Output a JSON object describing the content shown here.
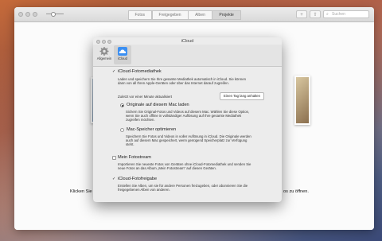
{
  "photos": {
    "tabs": [
      "Fotos",
      "Freigegeben",
      "Alben",
      "Projekte"
    ],
    "add_label": "+",
    "share_label": "⇧",
    "search_placeholder": "Suchen",
    "footer_left": "Klicken Sie",
    "footer_right": "os zu öffnen."
  },
  "prefs": {
    "title": "iCloud",
    "tabs": [
      {
        "label": "Allgemein",
        "icon": "gear-icon"
      },
      {
        "label": "iCloud",
        "icon": "cloud-icon"
      }
    ],
    "library": {
      "label": "iCloud-Fotomediathek",
      "checked": true,
      "description": "Laden und speichern Sie Ihre gesamte Mediathek automatisch in iCloud. Sie können dann von all Ihren Apple-Geräten oder über das Internet darauf zugreifen.",
      "status": "Zuletzt vor einer Minute aktualisiert",
      "pause_label": "Einen Tag lang anhalten",
      "option_originals": {
        "label": "Originale auf diesem Mac laden",
        "selected": true,
        "description": "Sichern Sie Original-Fotos und Videos auf diesem Mac. Wählen Sie diese Option, wenn Sie auch offline in vollständiger Auflösung auf Ihre gesamte Mediathek zugreifen möchten."
      },
      "option_optimize": {
        "label": "Mac-Speicher optimieren",
        "selected": false,
        "description": "Speichern Sie Fotos und Videos in voller Auflösung in iCloud. Die Originale werden auch auf diesem Mac gespeichert, wenn genügend Speicherplatz zur Verfügung steht."
      }
    },
    "photostream": {
      "label": "Mein Fotostream",
      "checked": false,
      "description": "Importieren Sie neueste Fotos von Geräten ohne iCloud-Fotomediathek und senden Sie neue Fotos an das Album „Mein Fotostream“ auf diesen Geräten."
    },
    "sharing": {
      "label": "iCloud-Fotofreigabe",
      "checked": true,
      "description": "Erstellen Sie Alben, um sie für andere Personen freizugeben, oder abonnieren Sie die freigegebenen Alben von anderen."
    },
    "checkmark": "✓",
    "accent_color": "#2f7ff0"
  }
}
